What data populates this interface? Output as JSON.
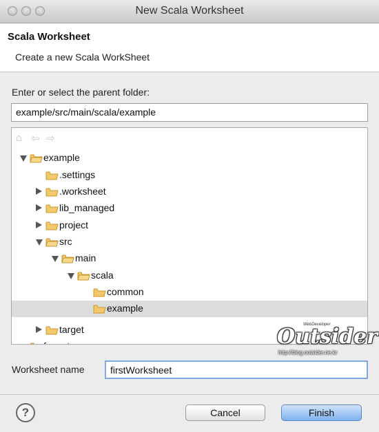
{
  "window": {
    "title": "New Scala Worksheet"
  },
  "header": {
    "title": "Scala Worksheet",
    "description": "Create a new Scala WorkSheet"
  },
  "folder": {
    "label": "Enter or select the parent folder:",
    "value": "example/src/main/scala/example"
  },
  "tree": {
    "items": [
      {
        "label": "example",
        "level": 0,
        "twisty": "open",
        "project": true
      },
      {
        "label": ".settings",
        "level": 1,
        "twisty": "none"
      },
      {
        "label": ".worksheet",
        "level": 1,
        "twisty": "closed"
      },
      {
        "label": "lib_managed",
        "level": 1,
        "twisty": "closed"
      },
      {
        "label": "project",
        "level": 1,
        "twisty": "closed"
      },
      {
        "label": "src",
        "level": 1,
        "twisty": "open"
      },
      {
        "label": "main",
        "level": 2,
        "twisty": "open"
      },
      {
        "label": "scala",
        "level": 3,
        "twisty": "open"
      },
      {
        "label": "common",
        "level": 4,
        "twisty": "none"
      },
      {
        "label": "example",
        "level": 4,
        "twisty": "none",
        "selected": true
      },
      {
        "label": "target",
        "level": 1,
        "twisty": "closed"
      },
      {
        "label": "funsets",
        "level": 0,
        "twisty": "open",
        "project": true
      }
    ]
  },
  "worksheet": {
    "label": "Worksheet name",
    "value": "firstWorksheet"
  },
  "buttons": {
    "help": "?",
    "cancel": "Cancel",
    "finish": "Finish"
  },
  "watermark": {
    "name": "Outsider",
    "url": "http://blog.outsider.ne.kr",
    "tag": "WebDeveloper"
  },
  "colors": {
    "folder": "#f3c86a",
    "selection": "#dcdcdc",
    "finish": "#7fb1ee"
  }
}
